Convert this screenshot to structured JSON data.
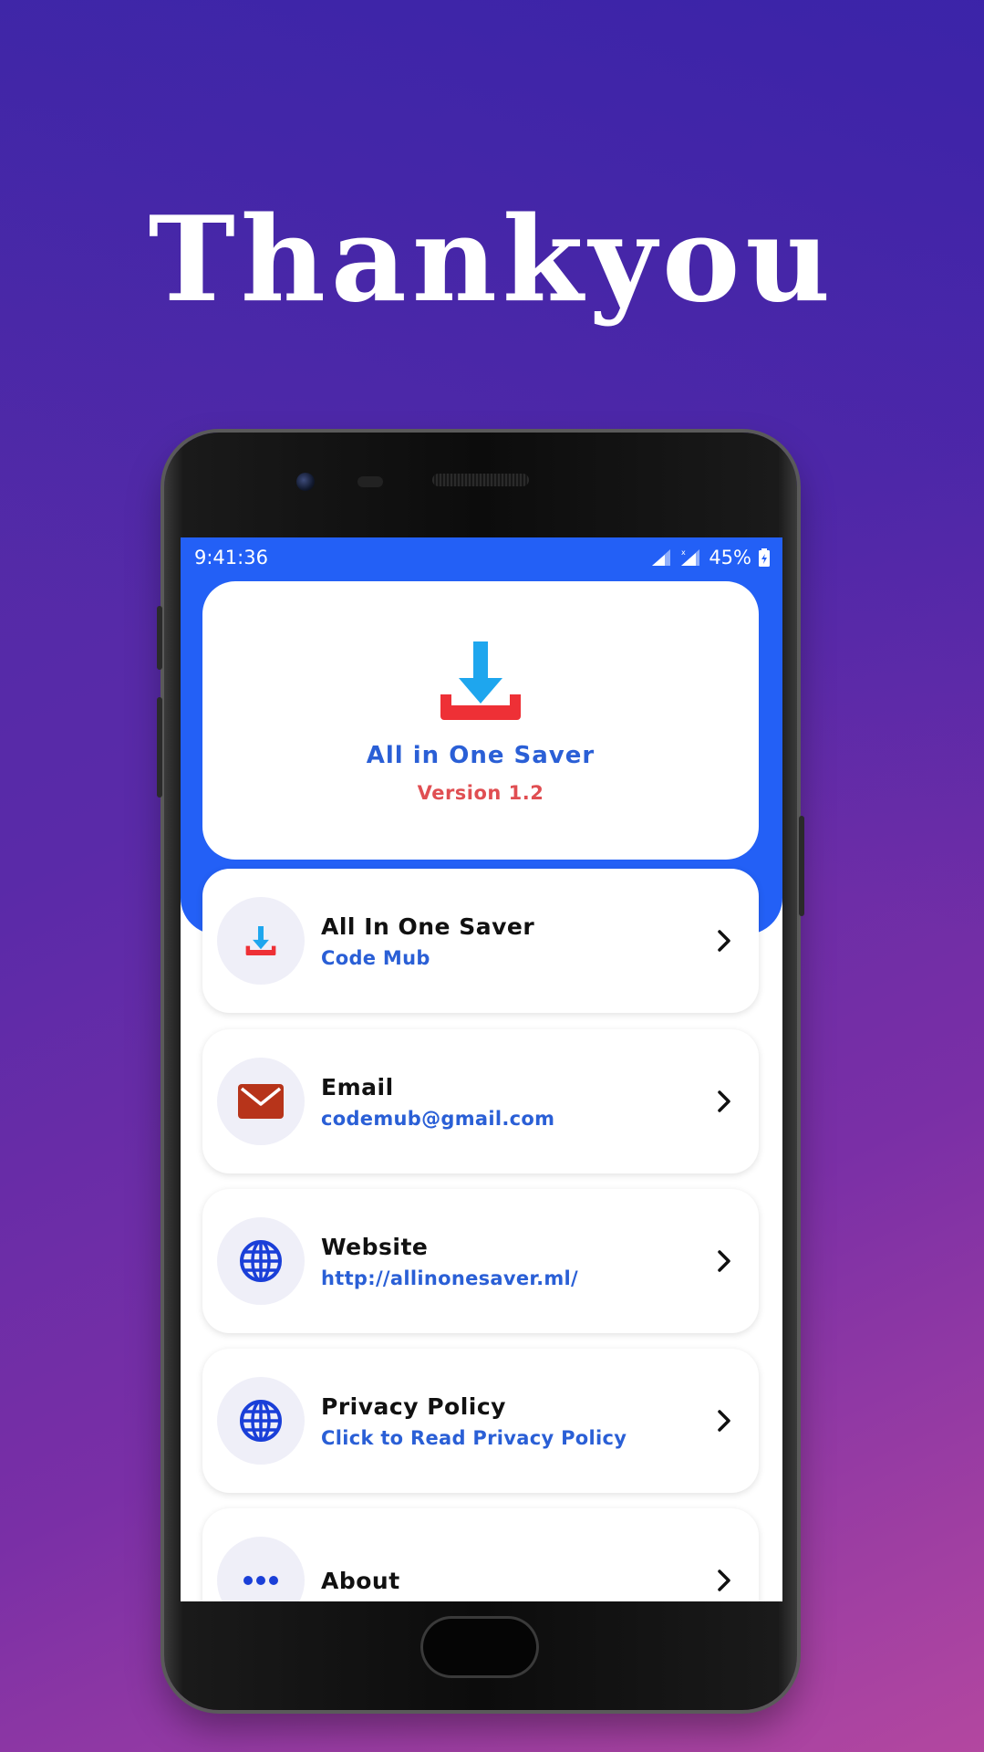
{
  "headline": "Thankyou",
  "status_bar": {
    "time": "9:41:36",
    "battery": "45%"
  },
  "app": {
    "name": "All in One Saver",
    "version": "Version 1.2"
  },
  "items": [
    {
      "title": "All In One Saver",
      "subtitle": "Code Mub",
      "icon": "download-icon"
    },
    {
      "title": "Email",
      "subtitle": "codemub@gmail.com",
      "icon": "mail-icon"
    },
    {
      "title": "Website",
      "subtitle": "http://allinonesaver.ml/",
      "icon": "globe-icon"
    },
    {
      "title": "Privacy Policy",
      "subtitle": "Click to Read Privacy Policy",
      "icon": "globe-icon"
    },
    {
      "title": "About",
      "subtitle": "",
      "icon": "more-dots-icon"
    }
  ],
  "colors": {
    "header_blue": "#2360f6",
    "accent_blue": "#2a5fd6",
    "version_red": "#e04e52",
    "icon_blue": "#1a3fd8",
    "mail_red": "#b7341a"
  }
}
